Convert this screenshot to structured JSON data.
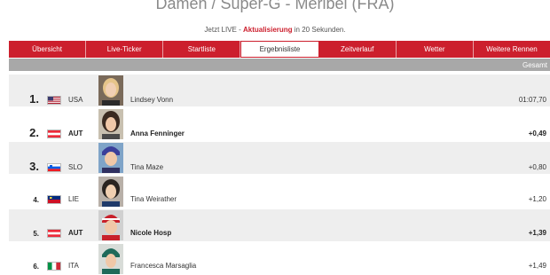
{
  "page": {
    "title": "Damen / Super-G - Meribel (FRA)",
    "live_prefix": "Jetzt LIVE - ",
    "live_action": "Aktualisierung",
    "live_suffix": " in 20 Sekunden."
  },
  "tabs": [
    {
      "label": "Übersicht",
      "active": false
    },
    {
      "label": "Live-Ticker",
      "active": false
    },
    {
      "label": "Startliste",
      "active": false
    },
    {
      "label": "Ergebnisliste",
      "active": true
    },
    {
      "label": "Zeitverlauf",
      "active": false
    },
    {
      "label": "Wetter",
      "active": false
    },
    {
      "label": "Weitere Rennen",
      "active": false
    }
  ],
  "header": {
    "gesamt": "Gesamt"
  },
  "colors": {
    "accent": "#cc1f2d",
    "header": "#a8a8a8",
    "row_alt": "#eeeeee"
  },
  "results": [
    {
      "rank": "1.",
      "nat": "USA",
      "flag": "usa-flag",
      "name": "Lindsey Vonn",
      "time": "01:07,70",
      "bold": false
    },
    {
      "rank": "2.",
      "nat": "AUT",
      "flag": "austria-flag",
      "name": "Anna Fenninger",
      "time": "+0,49",
      "bold": true
    },
    {
      "rank": "3.",
      "nat": "SLO",
      "flag": "slovenia-flag",
      "name": "Tina Maze",
      "time": "+0,80",
      "bold": false
    },
    {
      "rank": "4.",
      "nat": "LIE",
      "flag": "liechtenstein-flag",
      "name": "Tina Weirather",
      "time": "+1,20",
      "bold": false
    },
    {
      "rank": "5.",
      "nat": "AUT",
      "flag": "austria-flag",
      "name": "Nicole Hosp",
      "time": "+1,39",
      "bold": true
    },
    {
      "rank": "6.",
      "nat": "ITA",
      "flag": "italy-flag",
      "name": "Francesca Marsaglia",
      "time": "+1,49",
      "bold": false
    }
  ]
}
